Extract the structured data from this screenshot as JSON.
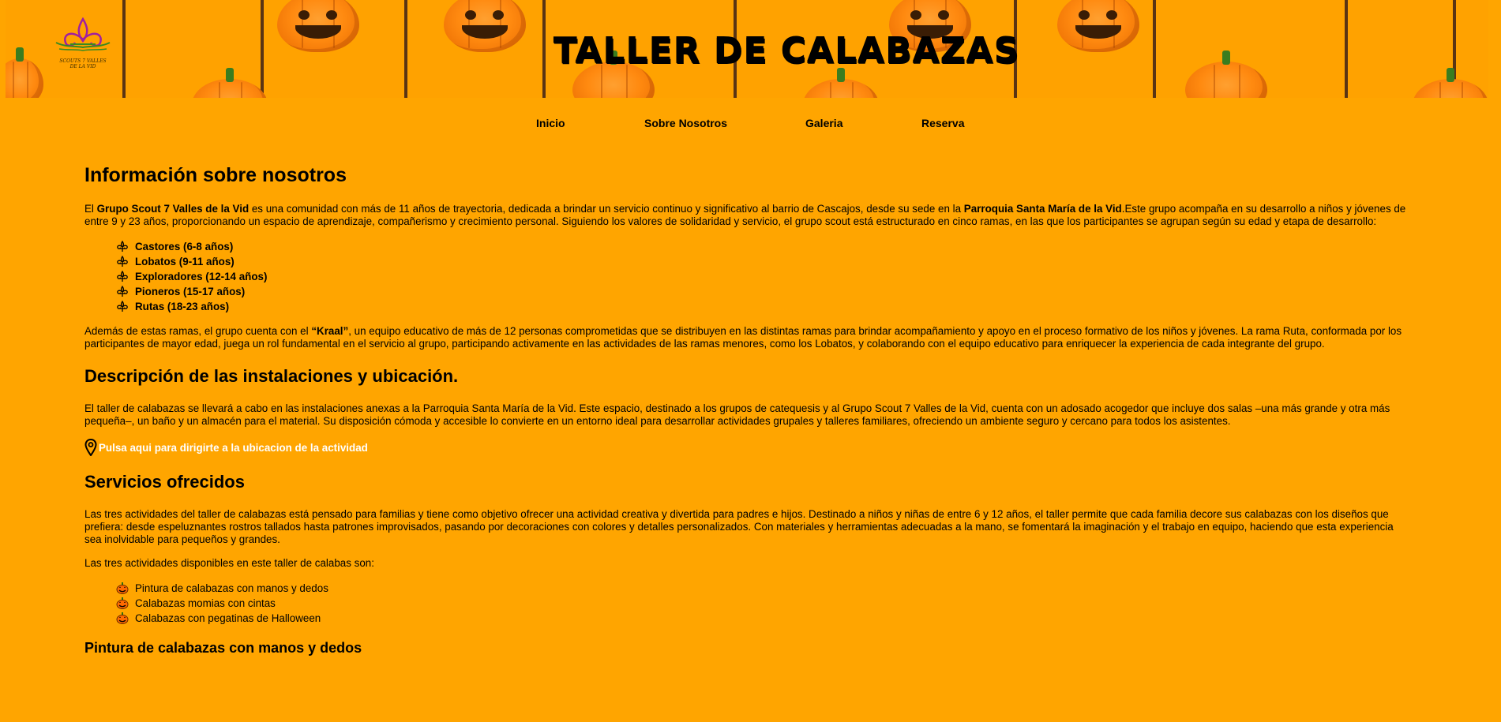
{
  "banner": {
    "title": "TALLER DE CALABAZAS",
    "logo_text_line1": "SCOUTS 7 VALLES",
    "logo_text_line2": "DE LA VID"
  },
  "nav": {
    "items": [
      {
        "label": "Inicio"
      },
      {
        "label": "Sobre Nosotros"
      },
      {
        "label": "Galeria"
      },
      {
        "label": "Reserva"
      }
    ]
  },
  "about": {
    "heading": "Información sobre nosotros",
    "intro": {
      "t1": "El ",
      "b1": "Grupo Scout 7 Valles de la Vid",
      "t2": " es una comunidad con más de 11 años de trayectoria, dedicada a brindar un servicio continuo y significativo al barrio de Cascajos, desde su sede en la ",
      "b2": "Parroquia Santa María de la Vid",
      "t3": ".Este grupo acompaña en su desarrollo a niños y jóvenes de entre 9 y 23 años, proporcionando un espacio de aprendizaje, compañerismo y crecimiento personal. Siguiendo los valores de solidaridad y servicio, el grupo scout está estructurado en cinco ramas, en las que los participantes se agrupan según su edad y etapa de desarrollo:"
    },
    "branches": [
      "Castores (6-8 años)",
      "Lobatos (9-11 años)",
      "Exploradores (12-14 años)",
      "Pioneros (15-17 años)",
      "Rutas (18-23 años)"
    ],
    "kraal": {
      "t1": "Además de estas ramas, el grupo cuenta con el ",
      "b1": "“Kraal”",
      "t2": ", un equipo educativo de más de 12 personas comprometidas que se distribuyen en las distintas ramas para brindar acompañamiento y apoyo en el proceso formativo de los niños y jóvenes. La rama Ruta, conformada por los participantes de mayor edad, juega un rol fundamental en el servicio al grupo, participando activamente en las actividades de las ramas menores, como los Lobatos, y colaborando con el equipo educativo para enriquecer la experiencia de cada integrante del grupo."
    }
  },
  "facilities": {
    "heading": "Descripción de las instalaciones y ubicación.",
    "text": "El taller de calabazas se llevará a cabo en las instalaciones anexas a la Parroquia Santa María de la Vid. Este espacio, destinado a los grupos de catequesis y al Grupo Scout 7 Valles de la Vid, cuenta con un adosado acogedor que incluye dos salas –una más grande y otra más pequeña–, un baño y un almacén para el material. Su disposición cómoda y accesible lo convierte en un entorno ideal para desarrollar actividades grupales y talleres familiares, ofreciendo un ambiente seguro y cercano para todos los asistentes.",
    "location_link": "Pulsa aqui para dirigirte a la ubicacion de la actividad"
  },
  "services": {
    "heading": "Servicios ofrecidos",
    "text": "Las tres actividades del taller de calabazas está pensado para familias y tiene como objetivo ofrecer una actividad creativa y divertida para padres e hijos. Destinado a niños y niñas de entre 6 y 12 años, el taller permite que cada familia decore sus calabazas con los diseños que prefiera: desde espeluznantes rostros tallados hasta patrones improvisados, pasando por decoraciones con colores y detalles personalizados. Con materiales y herramientas adecuadas a la mano, se fomentará la imaginación y el trabajo en equipo, haciendo que esta experiencia sea inolvidable para pequeños y grandes.",
    "list_intro": "Las tres actividades disponibles en este taller de calabas son:",
    "activities": [
      "Pintura de calabazas con manos y dedos",
      "Calabazas momias con cintas",
      "Calabazas con pegatinas de Halloween"
    ],
    "sub_heading": "Pintura de calabazas con manos y dedos"
  },
  "colors": {
    "page_bg": "#FFA500",
    "banner_bg": "#FFA200",
    "link_color": "#FFFFFF",
    "pole": "#5A3414"
  }
}
